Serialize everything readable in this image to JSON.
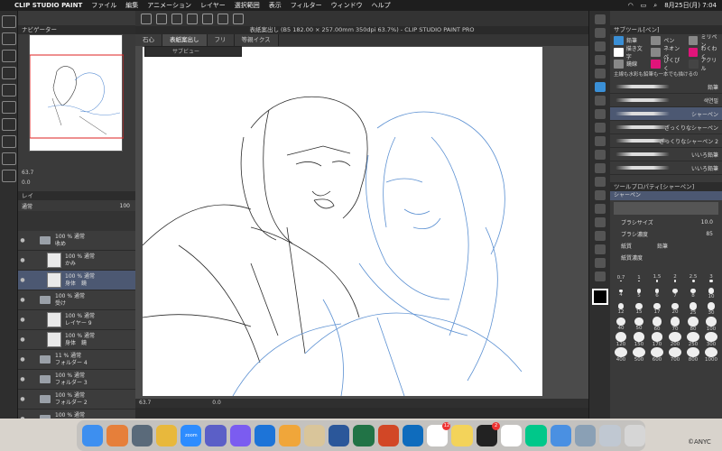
{
  "menubar": {
    "app_name": "CLIP STUDIO PAINT",
    "items": [
      "ファイル",
      "編集",
      "アニメーション",
      "レイヤー",
      "選択範囲",
      "表示",
      "フィルター",
      "ウィンドウ",
      "ヘルプ"
    ],
    "datetime": "8月25日(月)  7:04"
  },
  "document": {
    "title": "表紙案出し (B5 182.00 × 257.00mm 350dpi 63.7%) - CLIP STUDIO PAINT PRO",
    "tabs": [
      "石心",
      "表紙案出し",
      "フリ",
      "等親イクス"
    ],
    "active_tab": 1,
    "subview_label": "サブビュー",
    "zoom_bottom": "63.7",
    "angle_bottom": "0.0"
  },
  "navigator": {
    "tab_label": "ナビゲーター",
    "zoom": "63.7",
    "angle": "0.0"
  },
  "layers": {
    "tab_label": "レイ",
    "blend_mode": "通常",
    "opacity": "100",
    "rows": [
      {
        "line1": "100 % 通常",
        "line2": "收め",
        "type": "folder",
        "selected": false
      },
      {
        "line1": "100 % 通常",
        "line2": "かみ",
        "type": "layer",
        "selected": false
      },
      {
        "line1": "100 % 通常",
        "line2": "身体　鏡",
        "type": "layer",
        "selected": true
      },
      {
        "line1": "100 % 通常",
        "line2": "受け",
        "type": "folder",
        "selected": false
      },
      {
        "line1": "100 % 通常",
        "line2": "レイヤー 9",
        "type": "layer",
        "selected": false
      },
      {
        "line1": "100 % 通常",
        "line2": "身体　鏡",
        "type": "layer",
        "selected": false
      },
      {
        "line1": "11 % 通常",
        "line2": "フォルダー 4",
        "type": "folder",
        "selected": false
      },
      {
        "line1": "100 % 通常",
        "line2": "フォルダー 3",
        "type": "folder",
        "selected": false
      },
      {
        "line1": "100 % 通常",
        "line2": "フォルダー 2",
        "type": "folder",
        "selected": false
      },
      {
        "line1": "100 % 通常",
        "line2": "フォルダー 1",
        "type": "folder",
        "selected": false
      }
    ]
  },
  "subtool": {
    "title": "サブツール[ペン]",
    "groups": [
      {
        "label": "鉛筆",
        "color": "#3a8fd6"
      },
      {
        "label": "ペン",
        "color": "#888888"
      },
      {
        "label": "ミリペン",
        "color": "#888888"
      },
      {
        "label": "描き文字",
        "color": "#ffffff"
      },
      {
        "label": "ネオンペ",
        "color": "#888888"
      },
      {
        "label": "わくわく",
        "color": "#e0147a"
      },
      {
        "label": "鏡線",
        "color": "#888888"
      },
      {
        "label": "ぴくぴく",
        "color": "#e0147a"
      },
      {
        "label": "アクリル",
        "color": "#444444"
      }
    ],
    "filter_text": "主線も水彩も鉛筆も一本でも描けるの",
    "brushes": [
      {
        "name": "鉛筆",
        "selected": false
      },
      {
        "name": "색연필",
        "selected": false
      },
      {
        "name": "シャーペン",
        "selected": true
      },
      {
        "name": "ざっくりなシャーペン",
        "selected": false
      },
      {
        "name": "ざっくりなシャーペン 2",
        "selected": false
      },
      {
        "name": "いいろ鉛筆",
        "selected": false
      },
      {
        "name": "いいろ鉛筆",
        "selected": false
      }
    ]
  },
  "tool_property": {
    "title": "ツールプロパティ[シャーペン]",
    "tool_name": "シャーペン",
    "brush_size_label": "ブラシサイズ",
    "brush_size": "10.0",
    "brush_density_label": "ブラシ濃度",
    "brush_density": "85",
    "paper_label": "紙質",
    "paper_value": "鉛筆",
    "bottom_label": "紙質濃度"
  },
  "brush_sizes": [
    "0.7",
    "1",
    "1.5",
    "2",
    "2.5",
    "3",
    "4",
    "5",
    "6",
    "7",
    "8",
    "10",
    "12",
    "15",
    "17",
    "20",
    "25",
    "30",
    "40",
    "50",
    "60",
    "70",
    "80",
    "100",
    "120",
    "150",
    "170",
    "200",
    "250",
    "300",
    "400",
    "500",
    "600",
    "700",
    "800",
    "1000"
  ],
  "dock": {
    "apps": [
      {
        "name": "Finder",
        "color": "#3d8ff0"
      },
      {
        "name": "Launchpad",
        "color": "#e67f3a"
      },
      {
        "name": "Arc",
        "color": "#5a6a7a"
      },
      {
        "name": "Chrome",
        "color": "#e8b83c"
      },
      {
        "name": "zoom",
        "color": "#2d8cff"
      },
      {
        "name": "Teams",
        "color": "#5b5fc7"
      },
      {
        "name": "Messenger",
        "color": "#7b5cf0"
      },
      {
        "name": "OneDrive",
        "color": "#1d74d8"
      },
      {
        "name": "Photos",
        "color": "#f0a63a"
      },
      {
        "name": "Script",
        "color": "#d9c59a"
      },
      {
        "name": "Word",
        "color": "#2b579a"
      },
      {
        "name": "Excel",
        "color": "#217346"
      },
      {
        "name": "PowerPoint",
        "color": "#d24726"
      },
      {
        "name": "Outlook",
        "color": "#0f6cbd"
      },
      {
        "name": "Calendar",
        "color": "#ffffff",
        "badge": "12"
      },
      {
        "name": "Notes",
        "color": "#f3d35a"
      },
      {
        "name": "Steam",
        "color": "#222222",
        "badge": "2"
      },
      {
        "name": "CLIP",
        "color": "#ffffff"
      },
      {
        "name": "Webtoon",
        "color": "#00c88a"
      },
      {
        "name": "Finder2",
        "color": "#4a90e2"
      },
      {
        "name": "Preview",
        "color": "#8aa0b5"
      },
      {
        "name": "Desktop",
        "color": "#c0c8d2"
      },
      {
        "name": "Trash",
        "color": "#d6d6d6"
      }
    ],
    "zoom_label": "zoom",
    "corner_text": "©ANYC"
  }
}
